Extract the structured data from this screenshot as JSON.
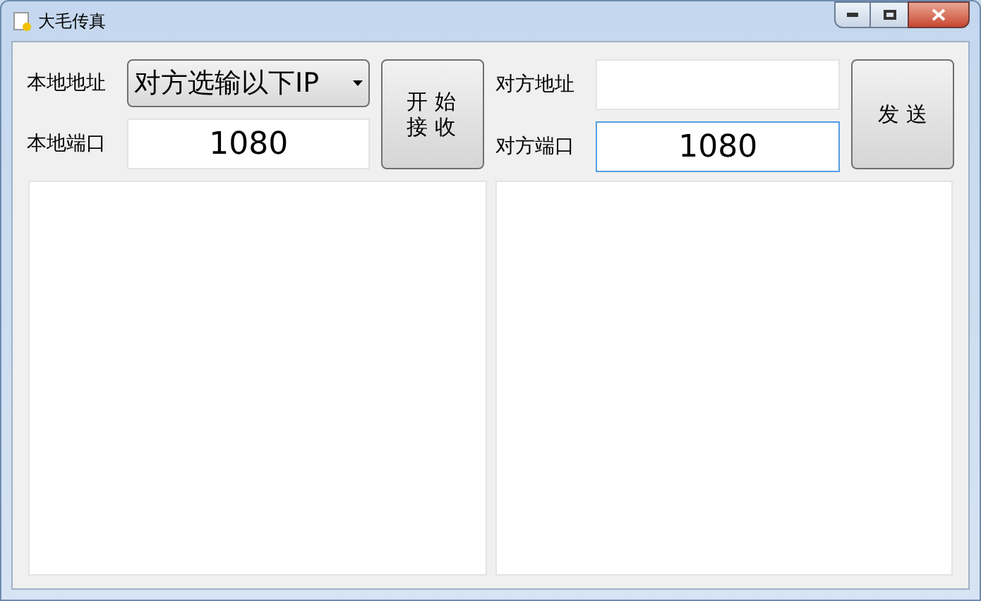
{
  "window": {
    "title": "大毛传真"
  },
  "local": {
    "address_label": "本地地址",
    "address_value": "对方选输以下IP",
    "port_label": "本地端口",
    "port_value": "1080"
  },
  "receive_button": "开 始接 收",
  "remote": {
    "address_label": "对方地址",
    "port_label": "对方端口",
    "port_value": "1080",
    "port_focused": true
  },
  "send_button": "发 送"
}
